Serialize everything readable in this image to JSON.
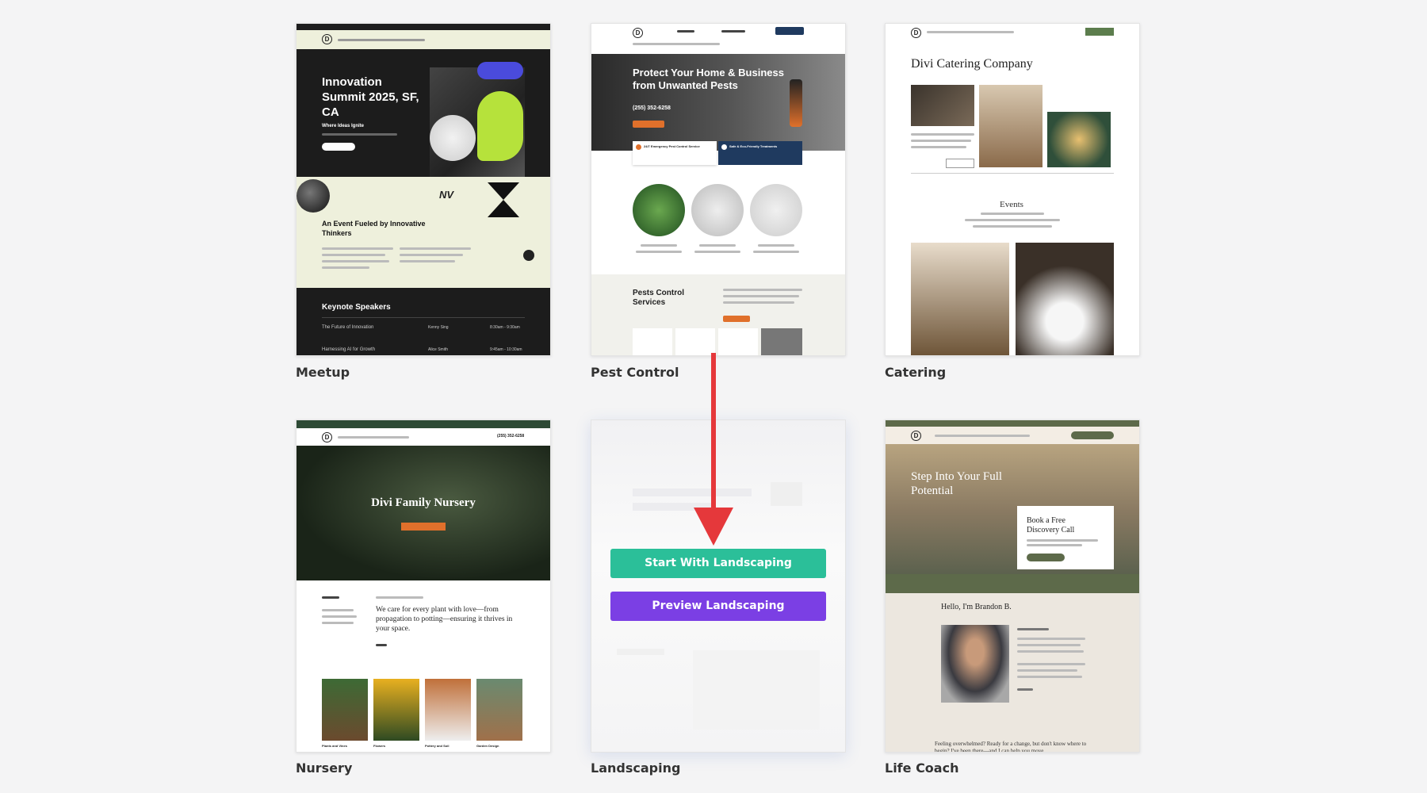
{
  "cards": {
    "meetup": {
      "label": "Meetup",
      "hero_title": "Innovation Summit 2025, SF, CA",
      "hero_tag": "Where Ideas Ignite",
      "event_title": "An Event Fueled by Innovative Thinkers",
      "speakers_heading": "Keynote Speakers",
      "talks": [
        {
          "title": "The Future of Innovation",
          "speaker": "Kenny Sing",
          "time": "8:30am - 9:30am"
        },
        {
          "title": "Harnessing AI for Growth",
          "speaker": "Alice Smith",
          "time": "9:45am - 10:30am"
        }
      ]
    },
    "pest_control": {
      "label": "Pest Control",
      "hero_title": "Protect Your Home & Business from Unwanted Pests",
      "phone": "(255) 352-6258",
      "feature_1": "24/7 Emergency Pest Control Service",
      "feature_2": "Safe & Eco-Friendly Treatments",
      "services_heading": "Pests Control Services"
    },
    "catering": {
      "label": "Catering",
      "title": "Divi Catering Company",
      "events_heading": "Events"
    },
    "nursery": {
      "label": "Nursery",
      "phone": "(255) 352-6258",
      "hero_title": "Divi Family Nursery",
      "quote": "We care for every plant with love—from propagation to potting—ensuring it thrives in your space.",
      "thumbs": [
        "Plants and Vines",
        "Flowers",
        "Pottery and Soil",
        "Garden Design"
      ]
    },
    "landscaping": {
      "label": "Landscaping",
      "start_button": "Start With Landscaping",
      "preview_button": "Preview Landscaping"
    },
    "life_coach": {
      "label": "Life Coach",
      "hero_title": "Step Into Your Full Potential",
      "cta_title": "Book a Free Discovery Call",
      "hello": "Hello, I'm Brandon B.",
      "footer_text": "Feeling overwhelmed? Ready for a change, but don't know where to begin? I've been there—and I can help you move"
    }
  },
  "annotation": {
    "arrow_color": "#e5383b"
  },
  "colors": {
    "start_button": "#2bbf99",
    "preview_button": "#7b3fe4",
    "nursery_green": "#2d4a35",
    "coach_olive": "#5d6a4a",
    "meetup_lime": "#b6e23b",
    "meetup_blue": "#4a4bdc",
    "pest_orange": "#e0702b"
  }
}
